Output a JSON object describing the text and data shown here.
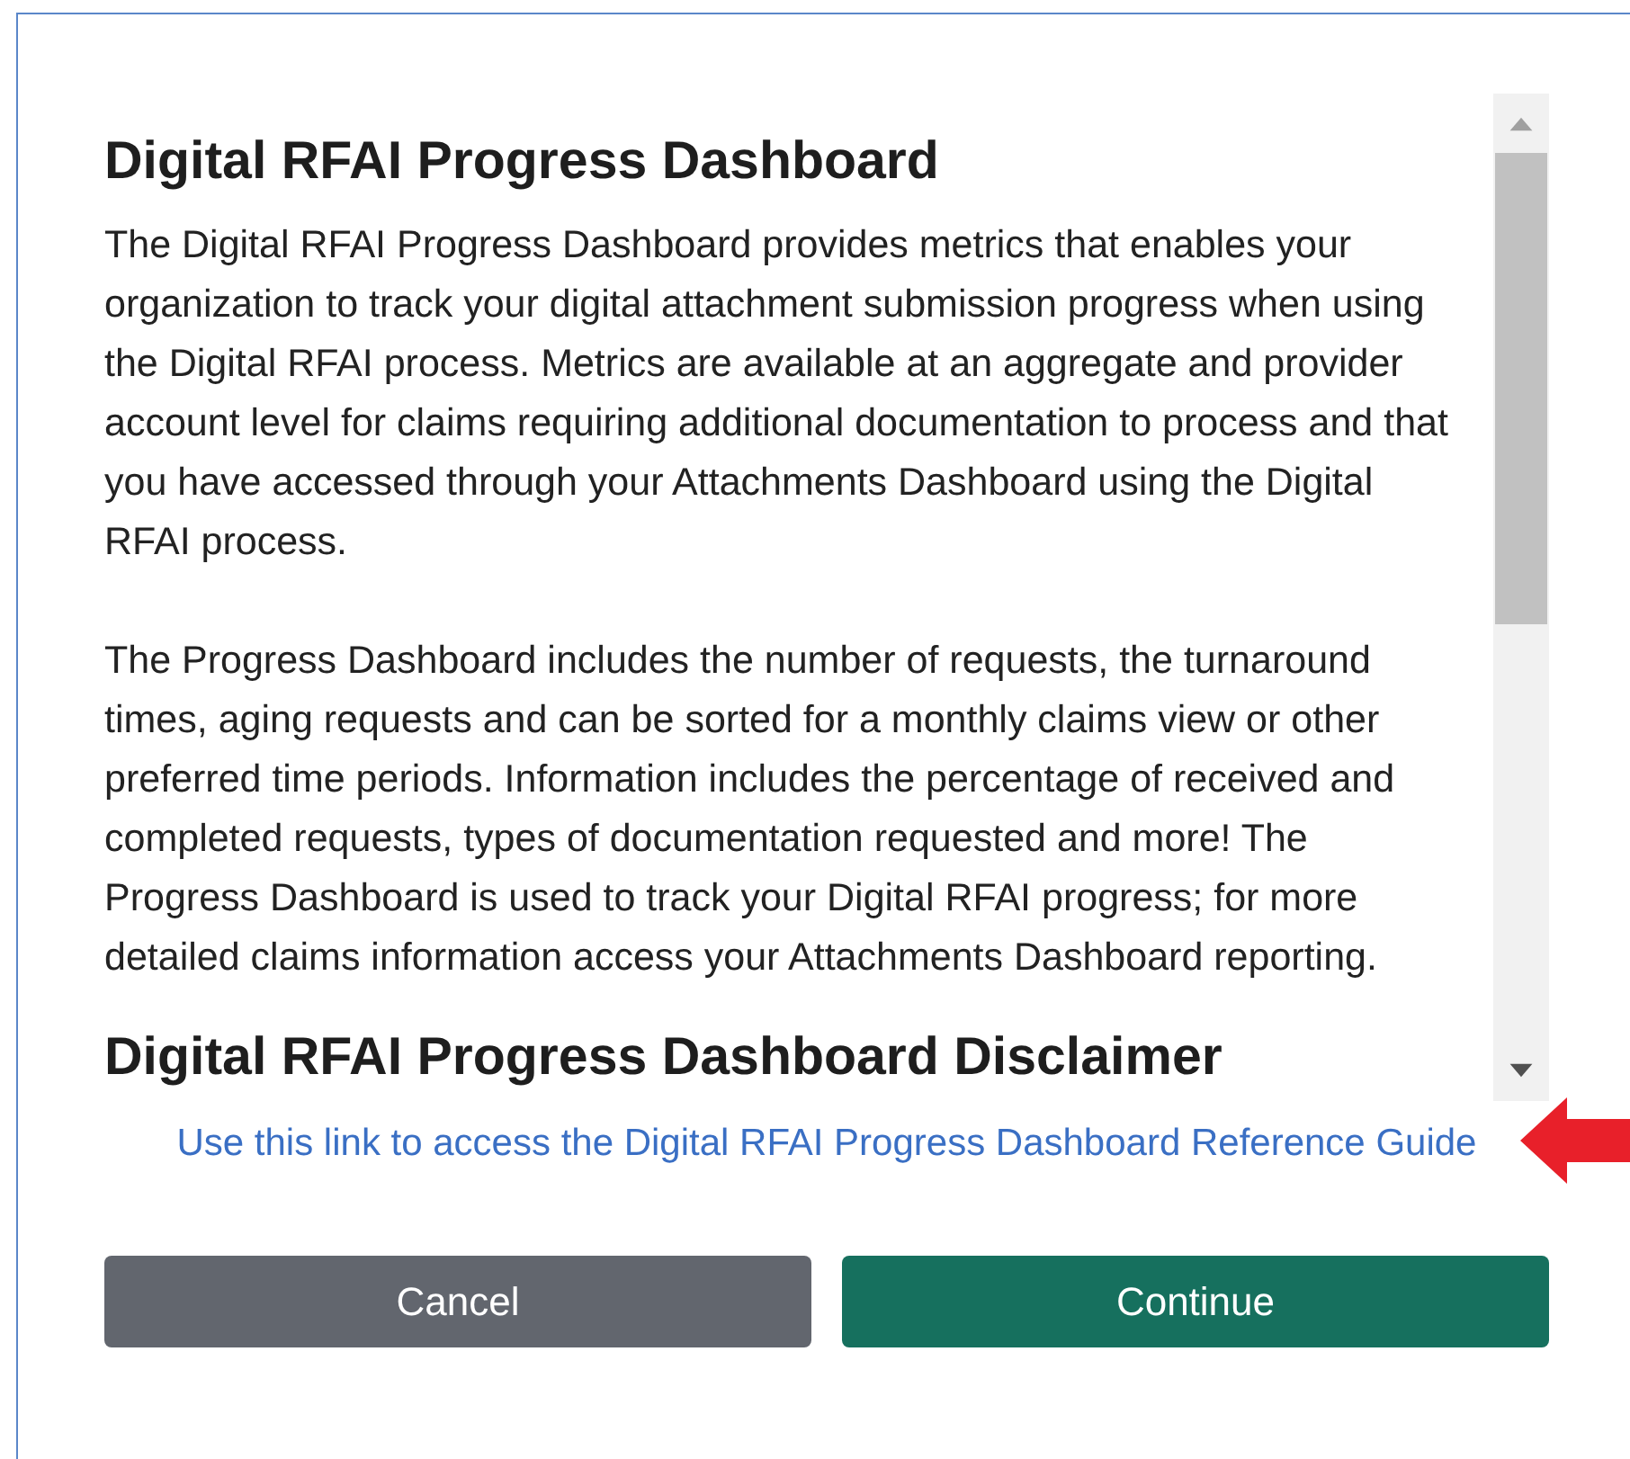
{
  "dialog": {
    "sections": [
      {
        "heading": "Digital RFAI Progress Dashboard",
        "paragraphs": [
          "The Digital RFAI Progress Dashboard provides metrics that enables your organization to track your digital attachment submission progress when using the Digital RFAI process. Metrics are available at an aggregate and provider account level for claims requiring additional documentation to process and that you have accessed through your Attachments Dashboard using the Digital RFAI process.",
          "The Progress Dashboard includes the number of requests, the turnaround times, aging requests and can be sorted for a monthly claims view or other preferred time periods. Information includes the percentage of received and completed requests, types of documentation requested and more! The Progress Dashboard is used to track your Digital RFAI progress; for more detailed claims information access your Attachments Dashboard reporting."
        ]
      },
      {
        "heading": "Digital RFAI Progress Dashboard Disclaimer"
      }
    ],
    "link": "Use this link to access the Digital RFAI Progress Dashboard Reference Guide",
    "buttons": [
      {
        "label": "Cancel",
        "kind": "secondary"
      },
      {
        "label": "Continue",
        "kind": "primary"
      }
    ]
  }
}
